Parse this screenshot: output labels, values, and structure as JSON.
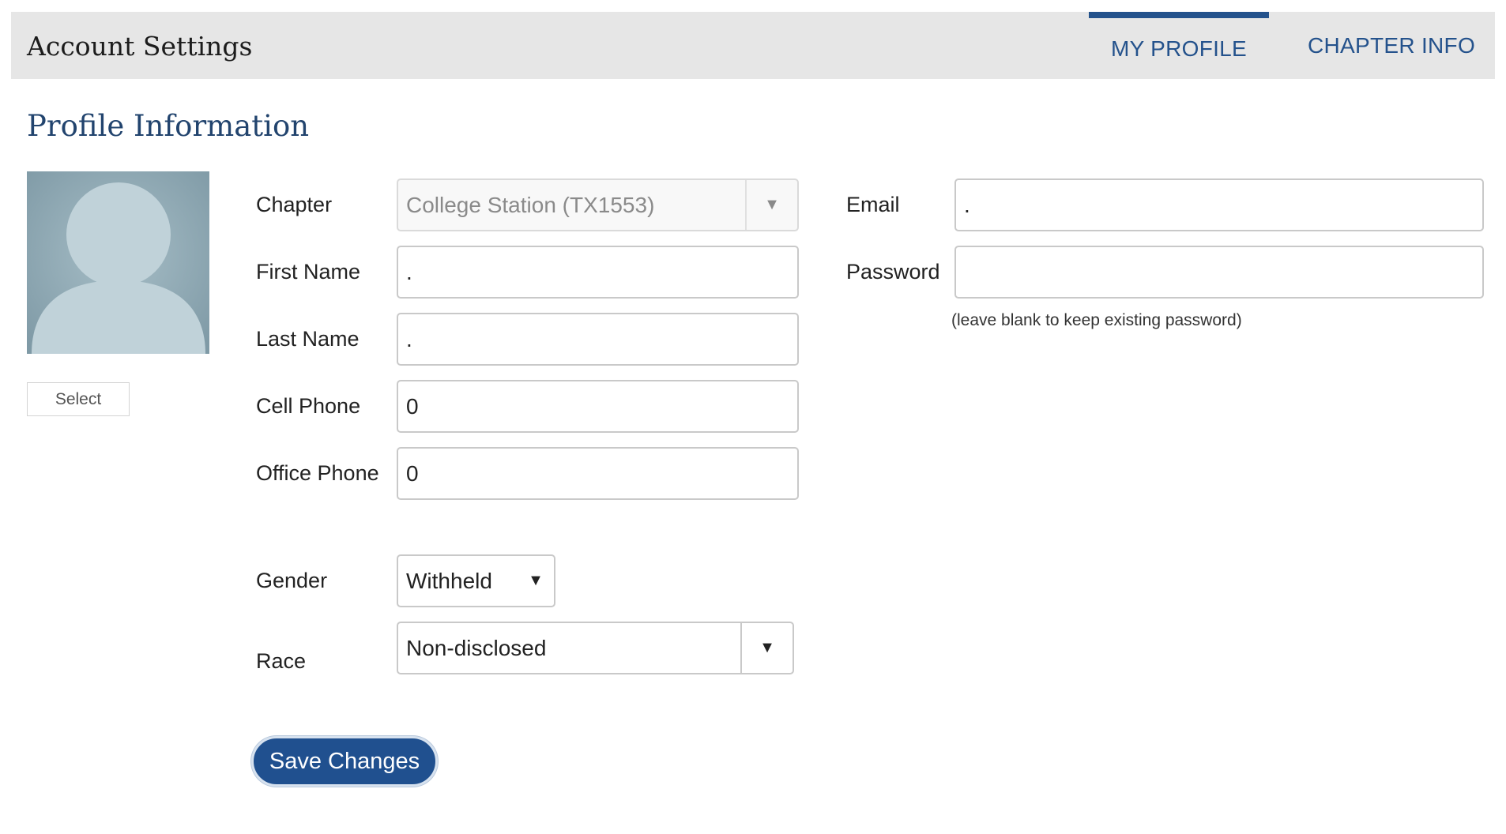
{
  "header": {
    "title": "Account Settings",
    "tabs": [
      {
        "label": "MY PROFILE",
        "active": true
      },
      {
        "label": "CHAPTER INFO",
        "active": false
      }
    ]
  },
  "section": {
    "title": "Profile Information"
  },
  "avatar": {
    "select_label": "Select"
  },
  "form": {
    "chapter": {
      "label": "Chapter",
      "value": "College Station (TX1553)",
      "disabled": true
    },
    "first_name": {
      "label": "First Name",
      "value": "."
    },
    "last_name": {
      "label": "Last Name",
      "value": "."
    },
    "cell_phone": {
      "label": "Cell Phone",
      "value": "0"
    },
    "office_phone": {
      "label": "Office Phone",
      "value": "0"
    },
    "gender": {
      "label": "Gender",
      "value": "Withheld"
    },
    "race": {
      "label": "Race",
      "value": "Non-disclosed"
    },
    "email": {
      "label": "Email",
      "value": "."
    },
    "password": {
      "label": "Password",
      "value": "",
      "hint": "(leave blank to keep existing password)"
    },
    "save_label": "Save Changes"
  },
  "icons": {
    "dropdown": "triangle-down-icon",
    "avatar": "person-silhouette-icon"
  },
  "colors": {
    "accent": "#24528c",
    "header_bg": "#e6e6e6",
    "button_bg": "#20508f",
    "avatar_bg": "#8ea8b3",
    "avatar_fg": "#c0d2d9"
  }
}
